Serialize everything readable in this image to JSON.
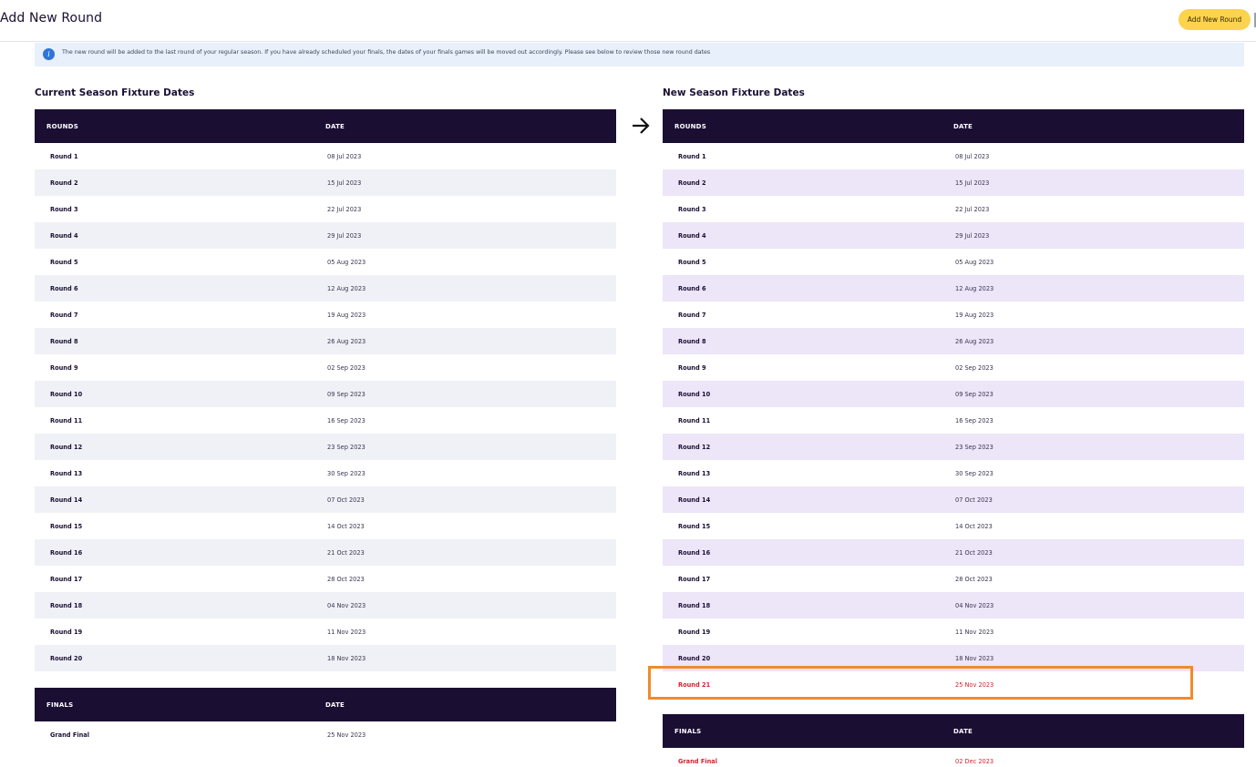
{
  "header": {
    "title": "Add New Round",
    "add_button_label": "Add New Round"
  },
  "info": {
    "icon": "info-icon",
    "text": "The new round will be added to the last round of your regular season. If you have already scheduled your finals, the dates of your finals games will be moved out accordingly. Please see below to review those new round dates"
  },
  "current": {
    "title": "Current Season Fixture Dates",
    "columns": [
      "ROUNDS",
      "DATE"
    ],
    "rows": [
      {
        "round": "Round 1",
        "date": "08 Jul 2023"
      },
      {
        "round": "Round 2",
        "date": "15 Jul 2023"
      },
      {
        "round": "Round 3",
        "date": "22 Jul 2023"
      },
      {
        "round": "Round 4",
        "date": "29 Jul 2023"
      },
      {
        "round": "Round 5",
        "date": "05 Aug 2023"
      },
      {
        "round": "Round 6",
        "date": "12 Aug 2023"
      },
      {
        "round": "Round 7",
        "date": "19 Aug 2023"
      },
      {
        "round": "Round 8",
        "date": "26 Aug 2023"
      },
      {
        "round": "Round 9",
        "date": "02 Sep 2023"
      },
      {
        "round": "Round 10",
        "date": "09 Sep 2023"
      },
      {
        "round": "Round 11",
        "date": "16 Sep 2023"
      },
      {
        "round": "Round 12",
        "date": "23 Sep 2023"
      },
      {
        "round": "Round 13",
        "date": "30 Sep 2023"
      },
      {
        "round": "Round 14",
        "date": "07 Oct 2023"
      },
      {
        "round": "Round 15",
        "date": "14 Oct 2023"
      },
      {
        "round": "Round 16",
        "date": "21 Oct 2023"
      },
      {
        "round": "Round 17",
        "date": "28 Oct 2023"
      },
      {
        "round": "Round 18",
        "date": "04 Nov 2023"
      },
      {
        "round": "Round 19",
        "date": "11 Nov 2023"
      },
      {
        "round": "Round 20",
        "date": "18 Nov 2023"
      }
    ],
    "finals_columns": [
      "FINALS",
      "DATE"
    ],
    "finals": [
      {
        "round": "Grand Final",
        "date": "25 Nov 2023"
      }
    ]
  },
  "new": {
    "title": "New Season Fixture Dates",
    "columns": [
      "ROUNDS",
      "DATE"
    ],
    "rows": [
      {
        "round": "Round 1",
        "date": "08 Jul 2023"
      },
      {
        "round": "Round 2",
        "date": "15 Jul 2023"
      },
      {
        "round": "Round 3",
        "date": "22 Jul 2023"
      },
      {
        "round": "Round 4",
        "date": "29 Jul 2023"
      },
      {
        "round": "Round 5",
        "date": "05 Aug 2023"
      },
      {
        "round": "Round 6",
        "date": "12 Aug 2023"
      },
      {
        "round": "Round 7",
        "date": "19 Aug 2023"
      },
      {
        "round": "Round 8",
        "date": "26 Aug 2023"
      },
      {
        "round": "Round 9",
        "date": "02 Sep 2023"
      },
      {
        "round": "Round 10",
        "date": "09 Sep 2023"
      },
      {
        "round": "Round 11",
        "date": "16 Sep 2023"
      },
      {
        "round": "Round 12",
        "date": "23 Sep 2023"
      },
      {
        "round": "Round 13",
        "date": "30 Sep 2023"
      },
      {
        "round": "Round 14",
        "date": "07 Oct 2023"
      },
      {
        "round": "Round 15",
        "date": "14 Oct 2023"
      },
      {
        "round": "Round 16",
        "date": "21 Oct 2023"
      },
      {
        "round": "Round 17",
        "date": "28 Oct 2023"
      },
      {
        "round": "Round 18",
        "date": "04 Nov 2023"
      },
      {
        "round": "Round 19",
        "date": "11 Nov 2023"
      },
      {
        "round": "Round 20",
        "date": "18 Nov 2023"
      },
      {
        "round": "Round 21",
        "date": "25 Nov 2023"
      }
    ],
    "finals_columns": [
      "FINALS",
      "DATE"
    ],
    "finals": [
      {
        "round": "Grand Final",
        "date": "02 Dec 2023"
      }
    ]
  },
  "colors": {
    "header_bg": "#1b0e33",
    "accent_button": "#fcd34d",
    "changed_text": "#d2232f",
    "highlight_border": "#f08a2e"
  }
}
